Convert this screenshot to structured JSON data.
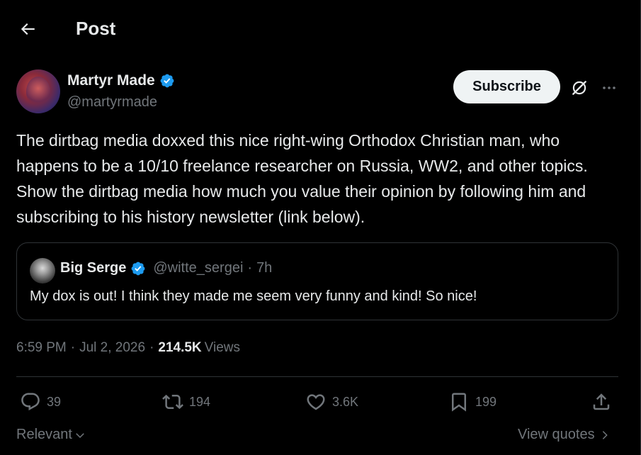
{
  "header": {
    "title": "Post"
  },
  "author": {
    "name": "Martyr Made",
    "handle": "@martyrmade"
  },
  "buttons": {
    "subscribe": "Subscribe"
  },
  "tweet": {
    "text": "The dirtbag media doxxed this nice right-wing Orthodox Christian man, who happens to be a 10/10 freelance researcher on Russia, WW2, and other topics. Show the dirtbag media how much you value their opinion by following him and subscribing to his history newsletter (link below)."
  },
  "quote": {
    "name": "Big Serge",
    "handle": "@witte_sergei",
    "separator": "·",
    "time": "7h",
    "text": "My dox is out! I think they made me seem very funny and kind! So nice!"
  },
  "meta": {
    "time": "6:59 PM",
    "sep1": "·",
    "date": "Jul 2, 2026",
    "sep2": "·",
    "views_count": "214.5K",
    "views_label": "Views"
  },
  "actions": {
    "replies": "39",
    "reposts": "194",
    "likes": "3.6K",
    "bookmarks": "199"
  },
  "footer": {
    "sort_label": "Relevant",
    "view_quotes": "View quotes"
  },
  "colors": {
    "background": "#000000",
    "text": "#e7e9ea",
    "muted": "#71767b",
    "verified": "#1d9bf0",
    "border": "#2f3336"
  },
  "icons": {
    "back": "arrow-left-icon",
    "verified": "verified-badge-icon",
    "grok": "grok-icon",
    "more": "more-dots-icon",
    "reply": "reply-icon",
    "repost": "repost-icon",
    "like": "heart-icon",
    "bookmark": "bookmark-icon",
    "share": "share-icon"
  }
}
